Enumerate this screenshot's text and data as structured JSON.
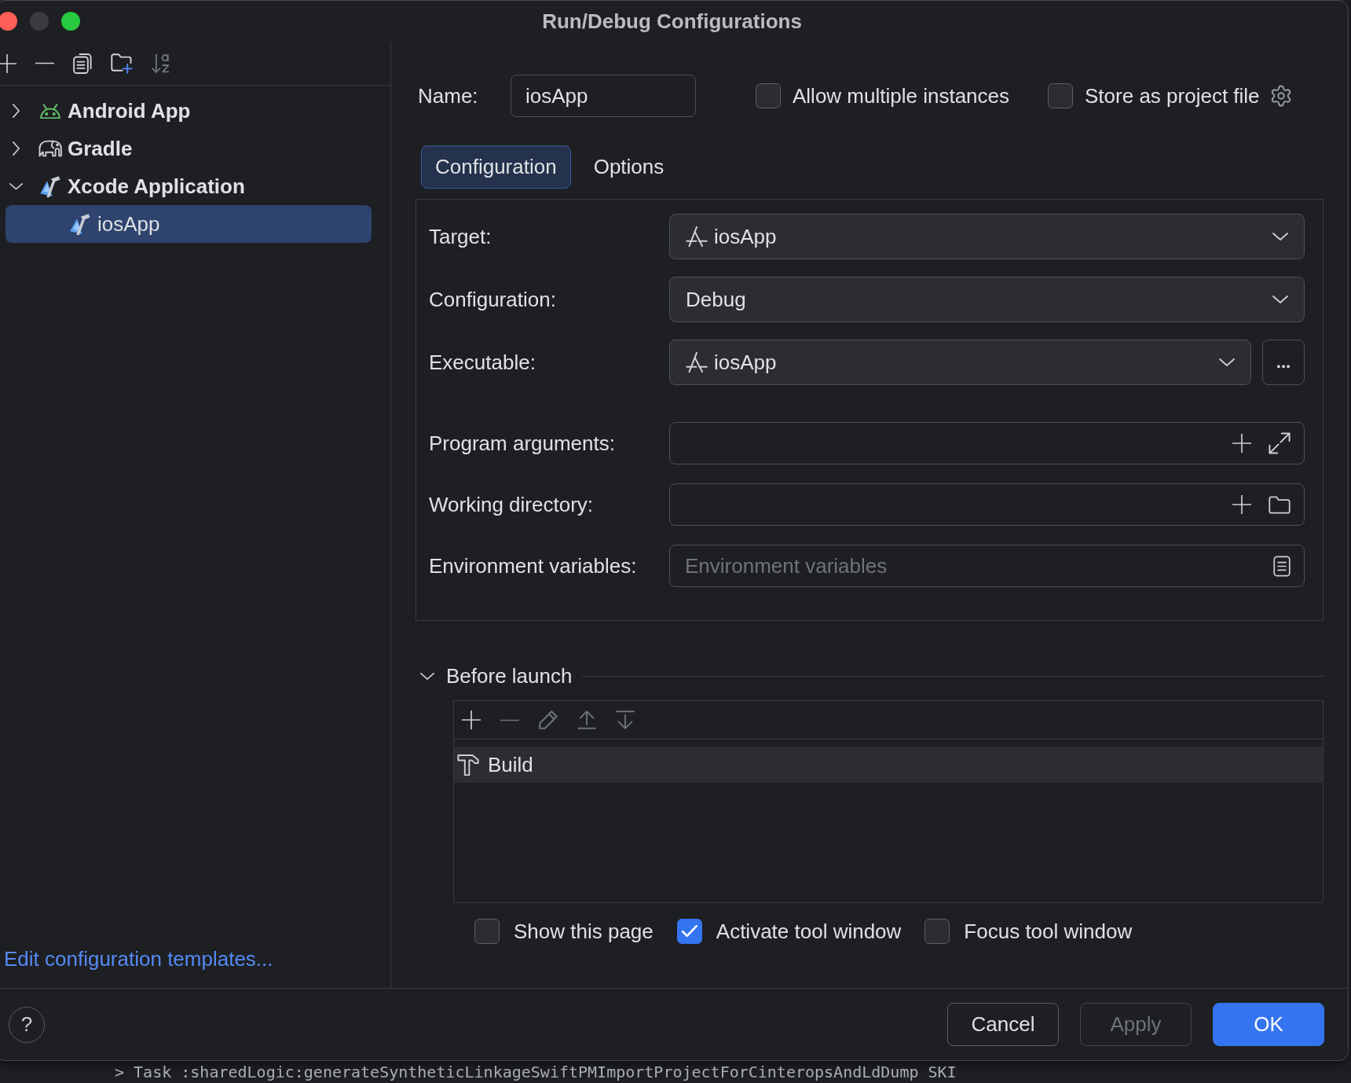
{
  "window": {
    "title": "Run/Debug Configurations"
  },
  "sidebar": {
    "toolbar": [
      {
        "kind": "add",
        "disabled": false
      },
      {
        "kind": "remove",
        "disabled": false
      },
      {
        "kind": "copy",
        "disabled": false
      },
      {
        "kind": "new-folder",
        "disabled": false
      },
      {
        "kind": "sort",
        "disabled": true
      }
    ],
    "tree": [
      {
        "label": "Android App",
        "kind": "android",
        "expanded": false,
        "selected": false
      },
      {
        "label": "Gradle",
        "kind": "gradle",
        "expanded": false,
        "selected": false
      },
      {
        "label": "Xcode Application",
        "kind": "xcode",
        "expanded": true,
        "selected": false,
        "children": [
          {
            "label": "iosApp",
            "kind": "xcode",
            "selected": true
          }
        ]
      }
    ],
    "templates_link": "Edit configuration templates..."
  },
  "name_row": {
    "label": "Name:",
    "value": "iosApp",
    "options": [
      {
        "label": "Allow multiple instances",
        "checked": false
      },
      {
        "label": "Store as project file",
        "checked": false
      }
    ]
  },
  "tabs": [
    {
      "label": "Configuration",
      "selected": true
    },
    {
      "label": "Options",
      "selected": false
    }
  ],
  "configuration": {
    "selects": [
      {
        "label": "Target:",
        "value": "iosApp",
        "app_icon": true
      },
      {
        "label": "Configuration:",
        "value": "Debug",
        "app_icon": false
      },
      {
        "label": "Executable:",
        "value": "iosApp",
        "app_icon": true,
        "browse": "..."
      }
    ],
    "inputs": [
      {
        "label": "Program arguments:",
        "kind": "arguments"
      },
      {
        "label": "Working directory:",
        "kind": "directory"
      },
      {
        "label": "Environment variables:",
        "kind": "environment",
        "placeholder": "Environment variables"
      }
    ]
  },
  "before_launch": {
    "title": "Before launch",
    "expanded": true,
    "toolbar": [
      {
        "kind": "add",
        "disabled": false
      },
      {
        "kind": "remove",
        "disabled": true
      },
      {
        "kind": "edit",
        "disabled": true
      },
      {
        "kind": "move-up",
        "disabled": true
      },
      {
        "kind": "move-down",
        "disabled": true
      }
    ],
    "tasks": [
      {
        "label": "Build",
        "kind": "build",
        "selected": true
      }
    ]
  },
  "launch_options": [
    {
      "label": "Show this page",
      "checked": false
    },
    {
      "label": "Activate tool window",
      "checked": true
    },
    {
      "label": "Focus tool window",
      "checked": false
    }
  ],
  "footer": {
    "help": "?",
    "buttons": [
      {
        "label": "Cancel",
        "kind": "secondary",
        "disabled": false
      },
      {
        "label": "Apply",
        "kind": "secondary",
        "disabled": true
      },
      {
        "label": "OK",
        "kind": "primary",
        "disabled": false
      }
    ]
  },
  "background_console": {
    "line": "> Task :sharedLogic:generateSyntheticLinkageSwiftPMImportProjectForCinteropsAndLdDump SKI"
  }
}
